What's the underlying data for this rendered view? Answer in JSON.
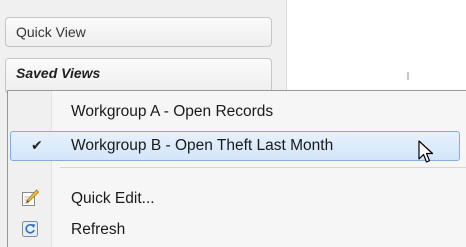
{
  "panel": {
    "quick_view_label": "Quick View",
    "saved_views_label": "Saved Views"
  },
  "context_menu": {
    "items": [
      {
        "label": "Workgroup A - Open Records",
        "checked": false,
        "icon": null
      },
      {
        "label": "Workgroup B - Open Theft Last Month",
        "checked": true,
        "highlighted": true,
        "icon": "checkmark-icon"
      },
      {
        "label": "Quick Edit...",
        "icon": "edit-pencil-icon"
      },
      {
        "label": "Refresh",
        "icon": "refresh-icon"
      }
    ],
    "check_glyph": "✔"
  },
  "colors": {
    "highlight_border": "#84acdd",
    "highlight_fill": "#d3e6f9"
  }
}
